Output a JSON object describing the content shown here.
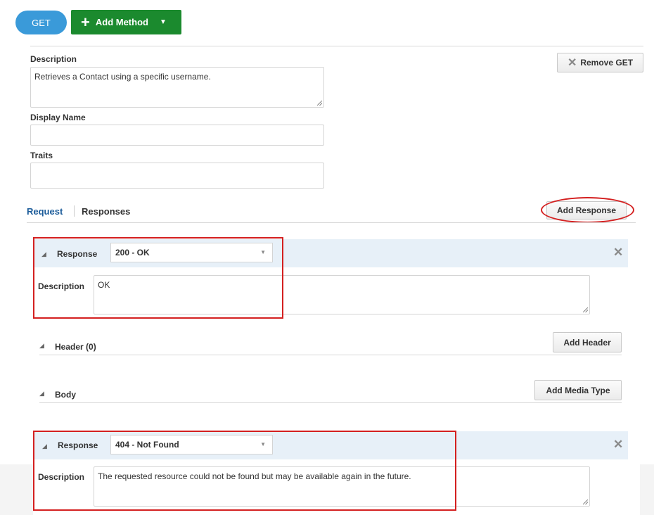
{
  "toolbar": {
    "method_label": "GET",
    "add_method_label": "Add Method"
  },
  "method_form": {
    "description_label": "Description",
    "description_value": "Retrieves a Contact using a specific username.",
    "display_name_label": "Display Name",
    "display_name_value": "",
    "traits_label": "Traits",
    "traits_value": "",
    "remove_button_label": "Remove GET"
  },
  "tabs": {
    "request_label": "Request",
    "responses_label": "Responses",
    "add_response_label": "Add Response"
  },
  "responses": [
    {
      "label": "Response",
      "status_value": "200 - OK",
      "description_label": "Description",
      "description_value": "OK"
    },
    {
      "label": "Response",
      "status_value": "404 - Not Found",
      "description_label": "Description",
      "description_value": "The requested resource could not be found but may be available again in the future."
    }
  ],
  "response_sections": {
    "header_label": "Header (0)",
    "add_header_label": "Add Header",
    "body_label": "Body",
    "add_media_type_label": "Add Media Type"
  },
  "colors": {
    "get_pill": "#3a9ad9",
    "add_method": "#1b8a2e",
    "response_header_bg": "#e7f0f8",
    "highlight": "#d42020",
    "tab_active": "#1c5c9a"
  }
}
